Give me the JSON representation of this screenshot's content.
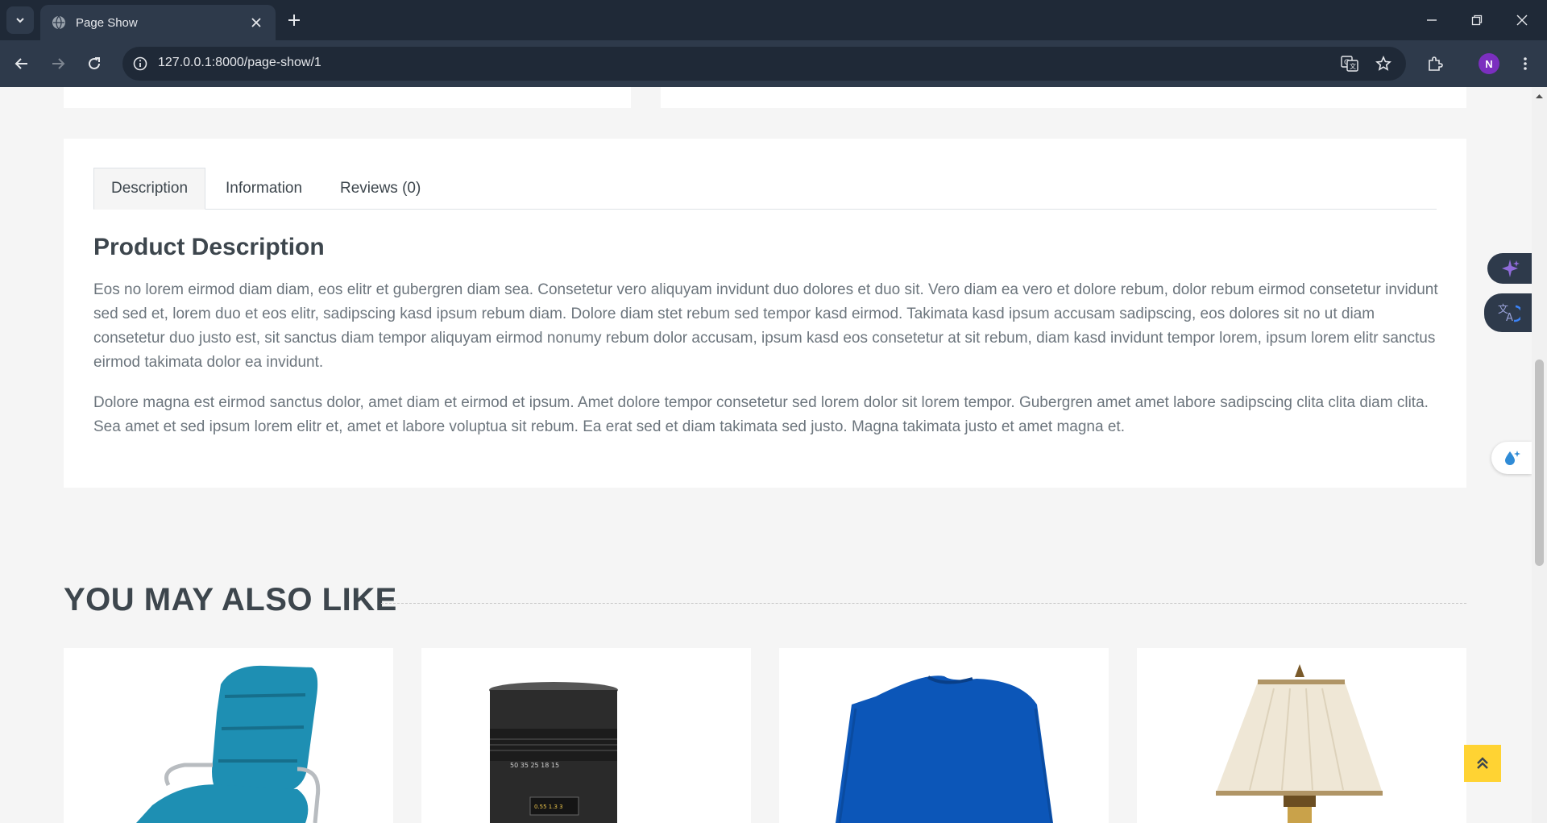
{
  "browser": {
    "tab_title": "Page Show",
    "url": "127.0.0.1:8000/page-show/1",
    "profile_initial": "N"
  },
  "tabs": [
    {
      "label": "Description",
      "active": true
    },
    {
      "label": "Information",
      "active": false
    },
    {
      "label": "Reviews (0)",
      "active": false
    }
  ],
  "description": {
    "title": "Product Description",
    "paragraph1": "Eos no lorem eirmod diam diam, eos elitr et gubergren diam sea. Consetetur vero aliquyam invidunt duo dolores et duo sit. Vero diam ea vero et dolore rebum, dolor rebum eirmod consetetur invidunt sed sed et, lorem duo et eos elitr, sadipscing kasd ipsum rebum diam. Dolore diam stet rebum sed tempor kasd eirmod. Takimata kasd ipsum accusam sadipscing, eos dolores sit no ut diam consetetur duo justo est, sit sanctus diam tempor aliquyam eirmod nonumy rebum dolor accusam, ipsum kasd eos consetetur at sit rebum, diam kasd invidunt tempor lorem, ipsum lorem elitr sanctus eirmod takimata dolor ea invidunt.",
    "paragraph2": "Dolore magna est eirmod sanctus dolor, amet diam et eirmod et ipsum. Amet dolore tempor consetetur sed lorem dolor sit lorem tempor. Gubergren amet amet labore sadipscing clita clita diam clita. Sea amet et sed ipsum lorem elitr et, amet et labore voluptua sit rebum. Ea erat sed et diam takimata sed justo. Magna takimata justo et amet magna et."
  },
  "related": {
    "title": "You May Also Like",
    "products": [
      {
        "image": "blue-office-chair-image"
      },
      {
        "image": "camera-lens-image"
      },
      {
        "image": "blue-sweater-image"
      },
      {
        "image": "table-lamp-image"
      }
    ]
  },
  "colors": {
    "accent": "#ffd333",
    "text_dark": "#3d464d",
    "text_muted": "#6c757d",
    "chrome_dark": "#1f2937",
    "chrome_mid": "#2e3a4b"
  }
}
